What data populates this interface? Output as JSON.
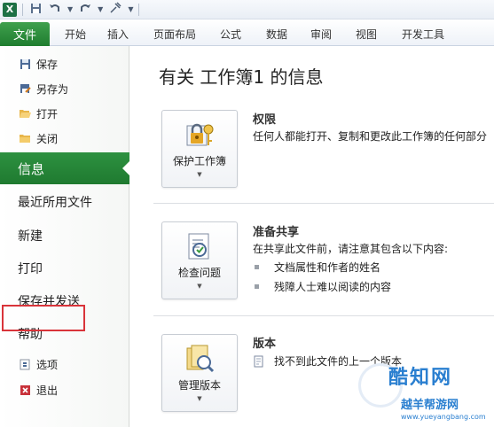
{
  "qat": {
    "logo": "X",
    "icons": [
      "save-icon",
      "undo-icon",
      "redo-icon",
      "customize-icon"
    ]
  },
  "ribbon": {
    "file_tab": "文件",
    "tabs": [
      "开始",
      "插入",
      "页面布局",
      "公式",
      "数据",
      "审阅",
      "视图",
      "开发工具"
    ]
  },
  "nav": {
    "save": "保存",
    "save_as": "另存为",
    "open": "打开",
    "close": "关闭",
    "info": "信息",
    "recent": "最近所用文件",
    "new": "新建",
    "print": "打印",
    "save_send": "保存并发送",
    "help": "帮助",
    "options": "选项",
    "exit": "退出"
  },
  "main": {
    "title": "有关 工作簿1 的信息",
    "permissions": {
      "button": "保护工作簿",
      "title": "权限",
      "desc": "任何人都能打开、复制和更改此工作簿的任何部分"
    },
    "prepare": {
      "button": "检查问题",
      "title": "准备共享",
      "desc": "在共享此文件前，请注意其包含以下内容:",
      "items": [
        "文档属性和作者的姓名",
        "残障人士难以阅读的内容"
      ]
    },
    "versions": {
      "button": "管理版本",
      "title": "版本",
      "desc": "找不到此文件的上一个版本"
    }
  },
  "watermark": {
    "brand": "酷知网",
    "sub": "越羊帮游网",
    "url": "www.yueyangbang.com"
  },
  "colors": {
    "file_tab": "#1f7d2f",
    "active_nav": "#2d9140",
    "highlight": "#d9343a"
  }
}
